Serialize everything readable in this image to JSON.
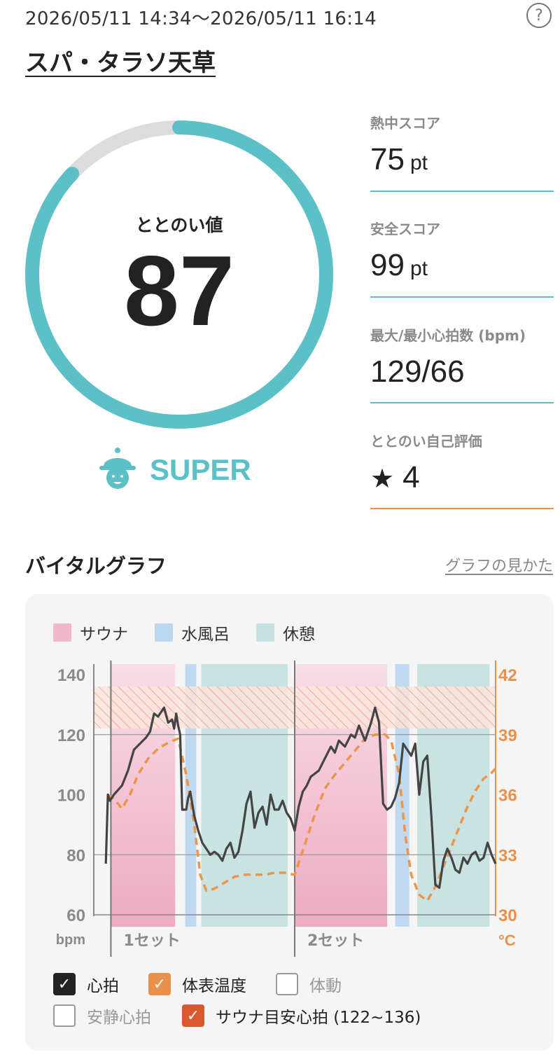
{
  "header": {
    "datetime_range": "2026/05/11 14:34～2026/05/11 16:14",
    "help_label": "?",
    "facility_name": "スパ・タラソ天草"
  },
  "score": {
    "label": "ととのい値",
    "value": "87",
    "fraction": 0.87,
    "rank": "SUPER",
    "colors": {
      "accent": "#5cc0c7",
      "track": "#dcdcdc"
    }
  },
  "metrics": [
    {
      "label": "熱中スコア",
      "value": "75",
      "unit": "pt"
    },
    {
      "label": "安全スコア",
      "value": "99",
      "unit": "pt"
    },
    {
      "label": "最大/最小心拍数 (bpm)",
      "value": "129/66",
      "unit": ""
    },
    {
      "label": "ととのい自己評価",
      "value": "4",
      "icon": "star-icon"
    }
  ],
  "vital": {
    "title": "バイタルグラフ",
    "howto_link": "グラフの見かた",
    "legend": [
      {
        "label": "サウナ",
        "color": "#f0b8cb"
      },
      {
        "label": "水風呂",
        "color": "#bcd7f0"
      },
      {
        "label": "休憩",
        "color": "#c6e2e0"
      }
    ],
    "checkboxes": [
      {
        "label": "心拍",
        "checked": true,
        "color": "#222222"
      },
      {
        "label": "体表温度",
        "checked": true,
        "color": "#e8914a"
      },
      {
        "label": "体動",
        "checked": false,
        "color": "#999999"
      },
      {
        "label": "安静心拍",
        "checked": false,
        "color": "#999999"
      },
      {
        "label": "サウナ目安心拍 (122~136)",
        "checked": true,
        "color": "#d9582f"
      }
    ]
  },
  "chart_data": {
    "type": "line",
    "left_axis": {
      "unit": "bpm",
      "ticks": [
        "140",
        "120",
        "100",
        "80",
        "60"
      ],
      "range": [
        60,
        140
      ]
    },
    "right_axis": {
      "unit": "°C",
      "ticks": [
        "42",
        "39",
        "36",
        "33",
        "30"
      ],
      "range": [
        30,
        42
      ]
    },
    "x_labels": [
      "1セット",
      "2セット"
    ],
    "band": {
      "label": "サウナ目安心拍 (122~136)",
      "range": [
        122,
        136
      ]
    },
    "phases": [
      {
        "type": "sauna",
        "start": 0.085,
        "end": 0.405
      },
      {
        "type": "cold",
        "start": 0.455,
        "end": 0.51
      },
      {
        "type": "rest",
        "start": 0.535,
        "end": 0.965
      },
      {
        "type": "sauna",
        "start": 1.0,
        "end": 1.46
      },
      {
        "type": "cold",
        "start": 1.5,
        "end": 1.57
      },
      {
        "type": "rest",
        "start": 1.61,
        "end": 1.97
      }
    ],
    "series": [
      {
        "name": "心拍",
        "axis": "left",
        "x": [
          0.06,
          0.07,
          0.08,
          0.1,
          0.14,
          0.17,
          0.2,
          0.23,
          0.26,
          0.28,
          0.3,
          0.32,
          0.35,
          0.37,
          0.39,
          0.4,
          0.41,
          0.42,
          0.43,
          0.44,
          0.46,
          0.47,
          0.48,
          0.5,
          0.52,
          0.54,
          0.56,
          0.58,
          0.6,
          0.62,
          0.64,
          0.66,
          0.68,
          0.7,
          0.72,
          0.74,
          0.76,
          0.78,
          0.8,
          0.82,
          0.84,
          0.86,
          0.88,
          0.9,
          0.92,
          0.94,
          0.96,
          0.98,
          1.0,
          1.02,
          1.04,
          1.06,
          1.08,
          1.1,
          1.12,
          1.15,
          1.18,
          1.2,
          1.22,
          1.25,
          1.28,
          1.3,
          1.32,
          1.35,
          1.38,
          1.4,
          1.42,
          1.44,
          1.46,
          1.48,
          1.5,
          1.52,
          1.54,
          1.56,
          1.58,
          1.6,
          1.62,
          1.64,
          1.66,
          1.68,
          1.7,
          1.72,
          1.74,
          1.76,
          1.78,
          1.8,
          1.82,
          1.84,
          1.86,
          1.88,
          1.9,
          1.92,
          1.94,
          1.96,
          1.98,
          2.0
        ],
        "values": [
          77,
          100,
          98,
          100,
          103,
          108,
          115,
          117,
          119,
          121,
          127,
          126,
          129,
          124,
          125,
          122,
          127,
          123,
          120,
          95,
          95,
          99,
          101,
          93,
          88,
          84,
          82,
          80,
          81,
          80,
          78,
          82,
          84,
          79,
          81,
          88,
          97,
          101,
          89,
          94,
          96,
          90,
          100,
          95,
          95,
          98,
          94,
          92,
          88,
          96,
          101,
          103,
          106,
          107,
          108,
          112,
          116,
          114,
          118,
          116,
          120,
          119,
          123,
          118,
          124,
          129,
          124,
          97,
          95,
          96,
          99,
          104,
          117,
          115,
          113,
          117,
          100,
          111,
          113,
          93,
          70,
          69,
          78,
          82,
          79,
          75,
          74,
          79,
          77,
          80,
          81,
          78,
          79,
          84,
          80,
          77
        ]
      },
      {
        "name": "体表温度",
        "axis": "right",
        "x": [
          0.07,
          0.1,
          0.14,
          0.18,
          0.22,
          0.27,
          0.32,
          0.37,
          0.42,
          0.46,
          0.5,
          0.53,
          0.56,
          0.6,
          0.65,
          0.7,
          0.75,
          0.8,
          0.85,
          0.9,
          0.95,
          1.0,
          1.05,
          1.1,
          1.15,
          1.2,
          1.25,
          1.3,
          1.35,
          1.4,
          1.45,
          1.48,
          1.52,
          1.55,
          1.58,
          1.62,
          1.66,
          1.7,
          1.74,
          1.78,
          1.82,
          1.86,
          1.9,
          1.94,
          1.98,
          2.0
        ],
        "values": [
          36.0,
          35.8,
          35.3,
          36.0,
          37.0,
          37.8,
          38.3,
          38.6,
          38.8,
          37.0,
          34.5,
          32.0,
          31.2,
          31.3,
          31.6,
          31.9,
          32.0,
          32.0,
          32.0,
          32.1,
          32.1,
          32.0,
          33.5,
          35.0,
          36.3,
          37.0,
          37.6,
          38.2,
          38.8,
          39.0,
          39.0,
          38.7,
          37.0,
          34.0,
          32.0,
          31.0,
          30.7,
          31.4,
          32.4,
          33.4,
          34.4,
          35.4,
          36.2,
          36.8,
          37.1,
          37.3
        ]
      }
    ]
  }
}
